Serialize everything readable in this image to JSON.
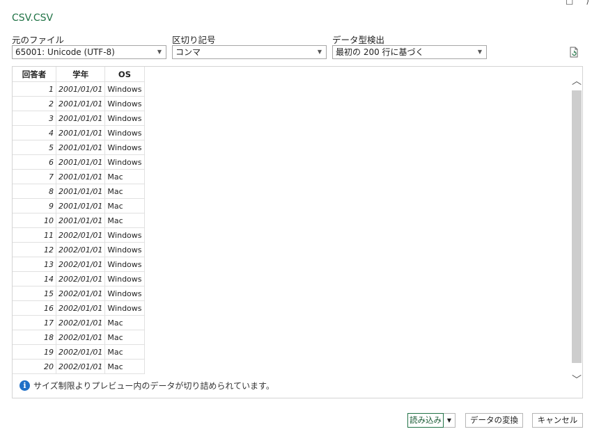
{
  "window": {
    "controls": [
      "□",
      "⟩"
    ]
  },
  "file_title": "CSV.CSV",
  "options": {
    "origin": {
      "label": "元のファイル",
      "value": "65001: Unicode (UTF-8)"
    },
    "delimiter": {
      "label": "区切り記号",
      "value": "コンマ"
    },
    "detection": {
      "label": "データ型検出",
      "value": "最初の 200 行に基づく"
    }
  },
  "table": {
    "headers": [
      "回答者",
      "学年",
      "OS"
    ],
    "rows": [
      [
        "1",
        "2001/01/01",
        "Windows"
      ],
      [
        "2",
        "2001/01/01",
        "Windows"
      ],
      [
        "3",
        "2001/01/01",
        "Windows"
      ],
      [
        "4",
        "2001/01/01",
        "Windows"
      ],
      [
        "5",
        "2001/01/01",
        "Windows"
      ],
      [
        "6",
        "2001/01/01",
        "Windows"
      ],
      [
        "7",
        "2001/01/01",
        "Mac"
      ],
      [
        "8",
        "2001/01/01",
        "Mac"
      ],
      [
        "9",
        "2001/01/01",
        "Mac"
      ],
      [
        "10",
        "2001/01/01",
        "Mac"
      ],
      [
        "11",
        "2002/01/01",
        "Windows"
      ],
      [
        "12",
        "2002/01/01",
        "Windows"
      ],
      [
        "13",
        "2002/01/01",
        "Windows"
      ],
      [
        "14",
        "2002/01/01",
        "Windows"
      ],
      [
        "15",
        "2002/01/01",
        "Windows"
      ],
      [
        "16",
        "2002/01/01",
        "Windows"
      ],
      [
        "17",
        "2002/01/01",
        "Mac"
      ],
      [
        "18",
        "2002/01/01",
        "Mac"
      ],
      [
        "19",
        "2002/01/01",
        "Mac"
      ],
      [
        "20",
        "2002/01/01",
        "Mac"
      ]
    ]
  },
  "notice": {
    "icon": "i",
    "text": "サイズ制限よりプレビュー内のデータが切り詰められています。"
  },
  "buttons": {
    "load": "読み込み",
    "transform": "データの変換",
    "cancel": "キャンセル"
  },
  "colors": {
    "accent": "#217346",
    "info": "#1e6fc7"
  }
}
